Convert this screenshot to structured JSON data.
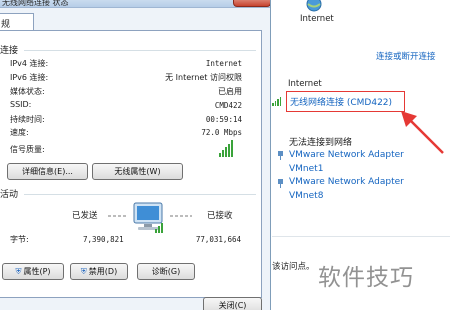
{
  "dialog": {
    "title": "无线网络连接 状态",
    "tab_label": "规",
    "connection": {
      "group_title": "连接",
      "rows": [
        {
          "label": "IPv4 连接:",
          "value": "Internet"
        },
        {
          "label": "IPv6 连接:",
          "value": "无 Internet 访问权限"
        },
        {
          "label": "媒体状态:",
          "value": "已启用"
        },
        {
          "label": "SSID:",
          "value": "CMD422"
        },
        {
          "label": "持续时间:",
          "value": "00:59:14"
        },
        {
          "label": "速度:",
          "value": "72.0 Mbps"
        }
      ],
      "signal_label": "信号质量:",
      "signal_bars": 5,
      "details_button": "详细信息(E)...",
      "wireless_props_button": "无线属性(W)"
    },
    "activity": {
      "group_title": "活动",
      "sent_label": "已发送",
      "received_label": "已接收",
      "bytes_label": "字节:",
      "bytes_sent": "7,390,821",
      "bytes_received": "77,031,664"
    },
    "buttons": {
      "properties": "属性(P)",
      "disable": "禁用(D)",
      "diagnose": "诊断(G)",
      "close": "关闭(C)"
    }
  },
  "right_pane": {
    "top_label": "Internet",
    "connect_link": "连接或断开连接",
    "section_internet": "Internet",
    "active_network": "无线网络连接 (CMD422)",
    "section_no_network": "无法连接到网络",
    "adapters": [
      {
        "name": "VMware Network Adapter",
        "sub": "VMnet1"
      },
      {
        "name": "VMware Network Adapter",
        "sub": "VMnet8"
      }
    ],
    "partial_text": "该访问点。"
  },
  "watermark": "软件技巧",
  "colors": {
    "link": "#1565c0",
    "highlight_box": "#e53935",
    "arrow": "#e53935",
    "signal": "#3aa33a"
  }
}
